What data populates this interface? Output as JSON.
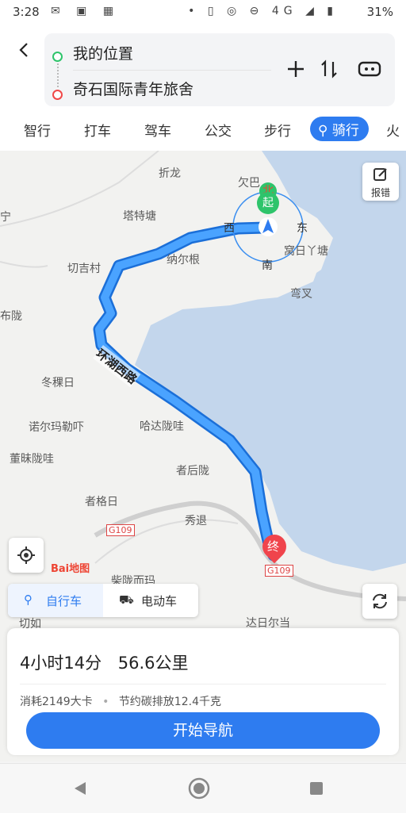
{
  "status": {
    "time": "3:28",
    "network": "4G",
    "battery": "31%"
  },
  "route": {
    "from": "我的位置",
    "to": "奇石国际青年旅舍"
  },
  "modes": [
    "智行",
    "打车",
    "驾车",
    "公交",
    "步行",
    "骑行",
    "火"
  ],
  "active_mode": "骑行",
  "map": {
    "report_label": "报错",
    "compass": {
      "north": "北",
      "south": "南",
      "east": "东",
      "west": "西"
    },
    "start_marker": "起",
    "end_marker": "终",
    "road_name": "环湖西路",
    "places": [
      "折龙",
      "欠巴",
      "塔特塘",
      "纳尔根",
      "窝日丫塘",
      "切吉村",
      "弯叉",
      "布陇",
      "冬稞日",
      "诺尔玛勒吓",
      "哈达陇哇",
      "董昧陇哇",
      "者后陇",
      "者格日",
      "秀退",
      "柴陇而玛",
      "切如",
      "达日尔当",
      "宁"
    ],
    "highway_labels": [
      "G109",
      "G109"
    ],
    "brand": "Bai地图",
    "vehicle_tabs": [
      "自行车",
      "电动车"
    ]
  },
  "card": {
    "duration": "4小时14分",
    "distance": "56.6公里",
    "calories": "消耗2149大卡",
    "carbon": "节约碳排放12.4千克",
    "start_button": "开始导航"
  }
}
